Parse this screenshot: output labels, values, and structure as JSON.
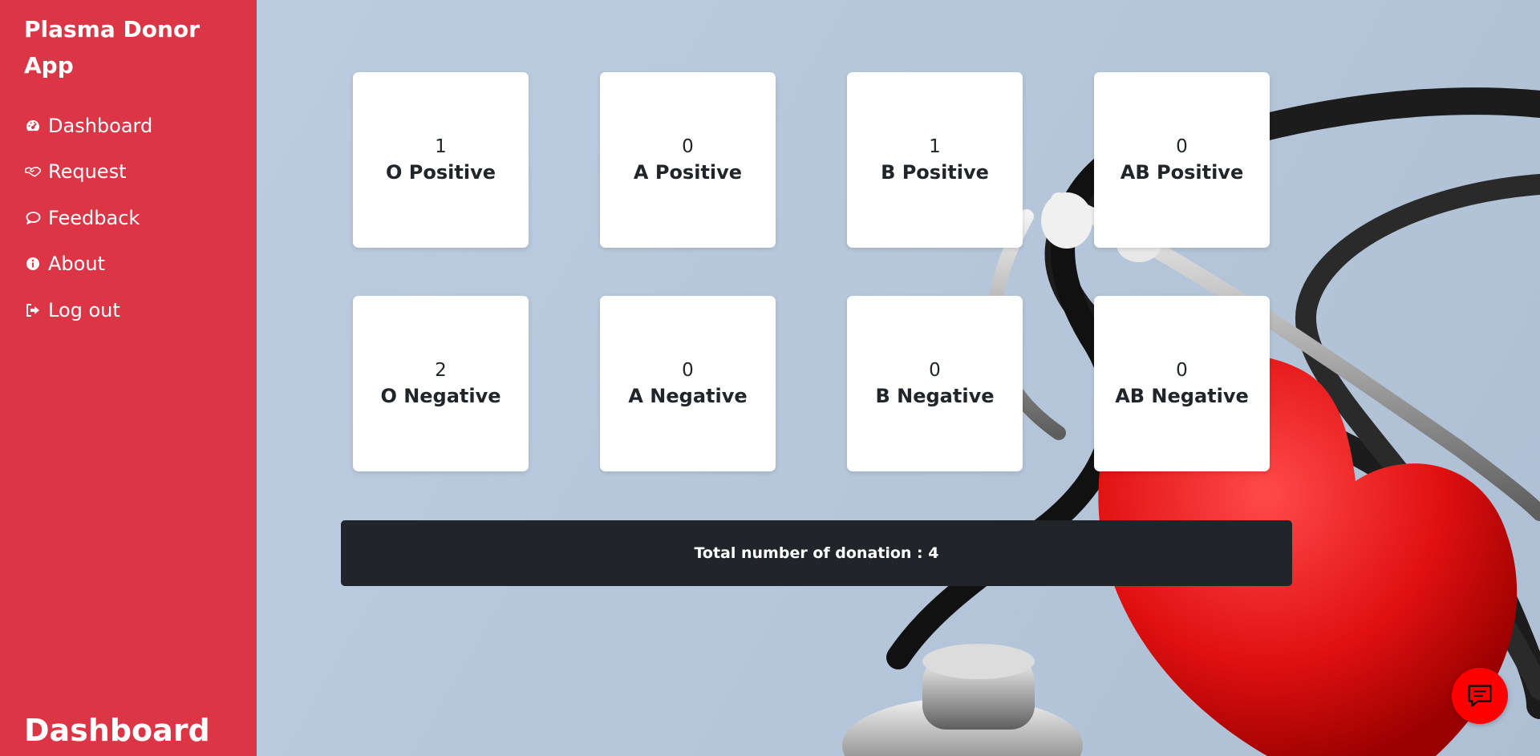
{
  "sidebar": {
    "brand": "Plasma Donor App",
    "items": [
      {
        "label": "Dashboard",
        "icon": "tachometer-icon"
      },
      {
        "label": "Request",
        "icon": "handshake-icon"
      },
      {
        "label": "Feedback",
        "icon": "chat-bubble-icon"
      },
      {
        "label": "About",
        "icon": "info-icon"
      },
      {
        "label": "Log out",
        "icon": "sign-out-icon"
      }
    ],
    "footer_title": "Dashboard"
  },
  "cards": [
    {
      "count": "1",
      "label": "O Positive"
    },
    {
      "count": "0",
      "label": "A Positive"
    },
    {
      "count": "1",
      "label": "B Positive"
    },
    {
      "count": "0",
      "label": "AB Positive"
    },
    {
      "count": "2",
      "label": "O Negative"
    },
    {
      "count": "0",
      "label": "A Negative"
    },
    {
      "count": "0",
      "label": "B Negative"
    },
    {
      "count": "0",
      "label": "AB Negative"
    }
  ],
  "total": {
    "text": "Total number of donation : 4"
  },
  "chat": {
    "icon": "chat-icon"
  },
  "colors": {
    "sidebar": "#dc3545",
    "total_bar": "#212529",
    "chat_button": "#ff0000"
  }
}
